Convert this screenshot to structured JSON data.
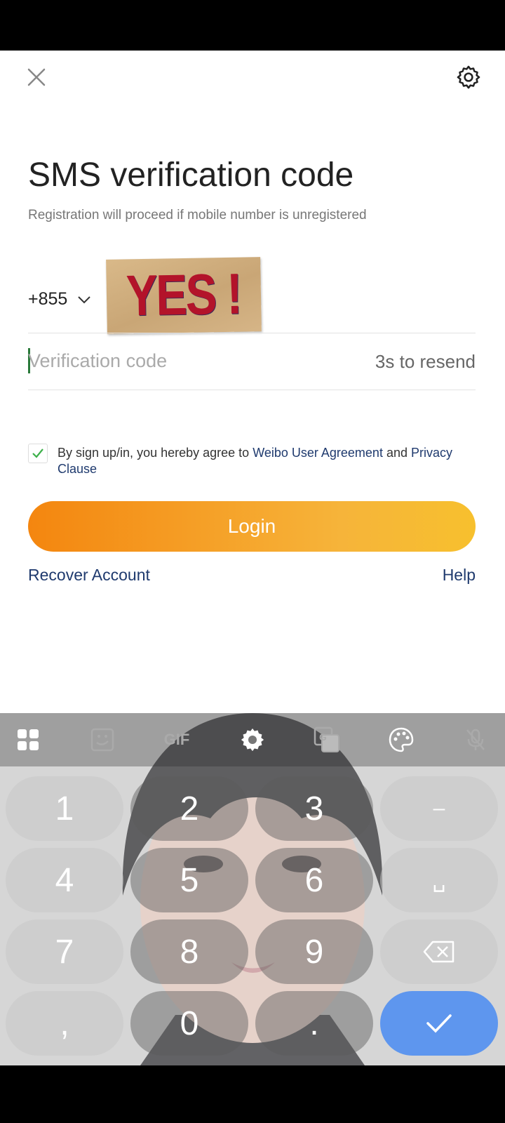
{
  "screen": {
    "title": "SMS verification code",
    "subtitle": "Registration will proceed if mobile number is unregistered",
    "country_code": "+855",
    "sticker_text": "YES !",
    "code_field": {
      "placeholder": "Verification code",
      "value": ""
    },
    "resend": "3s to resend",
    "agreement": {
      "checked": true,
      "prefix": "By sign up/in, you hereby agree to ",
      "link1": "Weibo User Agreement",
      "middle": " and ",
      "link2": "Privacy Clause"
    },
    "login_button": "Login",
    "recover_link": "Recover Account",
    "help_link": "Help"
  },
  "keyboard": {
    "toolbar": {
      "icons": [
        "apps-grid-icon",
        "sticker-icon",
        "gif-icon",
        "settings-icon",
        "translate-icon",
        "palette-icon",
        "mic-off-icon"
      ],
      "gif_label": "GIF",
      "translate_label": "G"
    },
    "keys": {
      "k1": "1",
      "k2": "2",
      "k3": "3",
      "dash": "–",
      "k4": "4",
      "k5": "5",
      "k6": "6",
      "space": "␣",
      "k7": "7",
      "k8": "8",
      "k9": "9",
      "comma": ",",
      "k0": "0",
      "period": "."
    },
    "accent_color": "#5e96ee"
  },
  "colors": {
    "login_gradient_start": "#f4860f",
    "login_gradient_end": "#f7c02e",
    "link": "#1f3a6e",
    "checkbox_check": "#3cb04a"
  }
}
